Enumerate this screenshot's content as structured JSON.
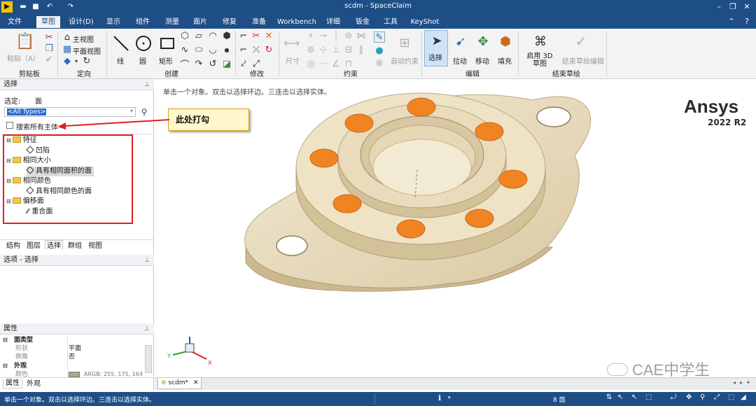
{
  "window": {
    "title": "scdm - SpaceClaim"
  },
  "menu": {
    "tabs": [
      "文件",
      "草图",
      "设计(D)",
      "显示",
      "组件",
      "测量",
      "面片",
      "修复",
      "准备",
      "Workbench",
      "详细",
      "钣金",
      "工具",
      "KeyShot"
    ],
    "active": "草图"
  },
  "ribbon": {
    "clipboard": {
      "paste": "粘贴（A）",
      "group": "剪贴板"
    },
    "orient": {
      "home": "主视图",
      "plane": "平面视图",
      "group": "定向"
    },
    "create": {
      "line": "线",
      "circle": "圆",
      "rect": "矩形",
      "group": "创建"
    },
    "modify": {
      "group": "修改"
    },
    "constraint": {
      "dim": "尺寸",
      "auto": "自动约束",
      "group": "约束"
    },
    "edit": {
      "select": "选择",
      "pull": "拉动",
      "move": "移动",
      "fill": "填充",
      "group": "编辑"
    },
    "finish": {
      "enable3d": "启用 3D 草图",
      "finish_edit": "结束草绘编辑",
      "group": "结束草绘"
    }
  },
  "select_panel": {
    "header": "选择",
    "selected_label": "选定:",
    "selected_value": "面",
    "filter": "<All Types>",
    "search_all": "搜索所有主体",
    "tree": [
      {
        "label": "特征",
        "child": "凹陷",
        "child_icon": "diamond"
      },
      {
        "label": "相同大小",
        "child": "具有相同面积的面",
        "child_icon": "diamond"
      },
      {
        "label": "相同颜色",
        "child": "具有相同颜色的面",
        "child_icon": "diamond"
      },
      {
        "label": "偏移面",
        "child": "重合面",
        "child_icon": "slash"
      }
    ],
    "tabs": [
      "结构",
      "图层",
      "选择",
      "群组",
      "视图"
    ],
    "active_tab": "选择"
  },
  "options_panel": {
    "header": "选项 - 选择"
  },
  "properties": {
    "header": "属性",
    "rows": [
      {
        "key": "面类型",
        "value": "",
        "bold": true
      },
      {
        "key": "形状",
        "value": "平面"
      },
      {
        "key": "倒角",
        "value": "否"
      },
      {
        "key": "外观",
        "value": "",
        "bold": true
      },
      {
        "key": "颜色",
        "value": "ARGB: 255, 175, 164"
      }
    ],
    "tabs": [
      "属性",
      "外观"
    ]
  },
  "viewport": {
    "hint": "单击一个对象。双击以选择环边。三连击以选择实体。",
    "brand": "Ansys",
    "version": "2022 R2",
    "annotation": "此处打勾",
    "watermark": "CAE中学生"
  },
  "doc_tab": {
    "name": "scdm*"
  },
  "status": {
    "hint": "单击一个对象。双击以选择环边。三连击以选择实体。",
    "count": "8 面"
  },
  "colors": {
    "accent": "#1e4e86",
    "part": "#ece0c4",
    "highlight": "#f08422",
    "callout_bg": "#fff8cc",
    "annotation": "#e02020"
  }
}
